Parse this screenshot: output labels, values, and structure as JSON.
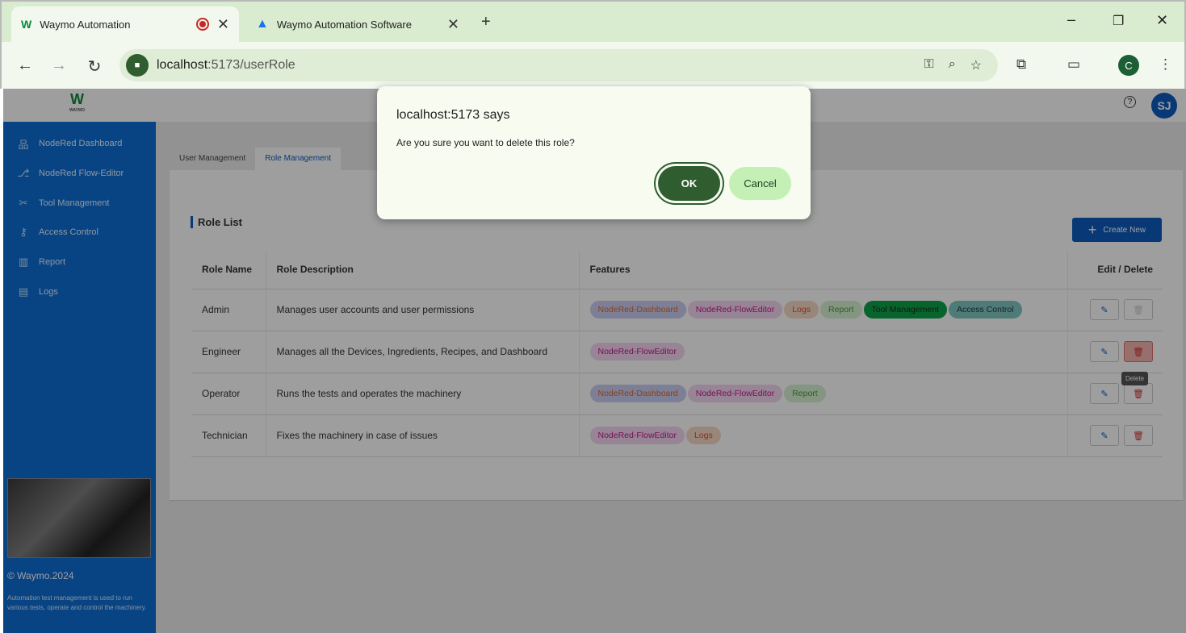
{
  "browser": {
    "tabs": [
      {
        "title": "Waymo Automation",
        "recording": true
      },
      {
        "title": "Waymo Automation Software"
      }
    ],
    "url_host": "localhost",
    "url_rest": ":5173/userRole",
    "profile_initial": "C"
  },
  "app": {
    "logo_text": "W",
    "logo_sub": "WAYMO",
    "user_initials": "SJ",
    "help_glyph": "?",
    "sidebar": [
      {
        "label": "NodeRed Dashboard",
        "icon": "dashboard-icon"
      },
      {
        "label": "NodeRed Flow-Editor",
        "icon": "flow-icon"
      },
      {
        "label": "Tool Management",
        "icon": "tools-icon"
      },
      {
        "label": "Access Control",
        "icon": "access-icon"
      },
      {
        "label": "Report",
        "icon": "report-icon"
      },
      {
        "label": "Logs",
        "icon": "logs-icon"
      }
    ],
    "copyright": "© Waymo.2024",
    "footer_desc": "Automation test management is used to run various tests, operate and control the machinery.",
    "tabs": [
      "User Management",
      "Role Management"
    ],
    "active_tab": "Role Management",
    "section_title": "Role List",
    "create_label": "Create New",
    "columns": [
      "Role Name",
      "Role Description",
      "Features",
      "Edit / Delete"
    ],
    "rows": [
      {
        "name": "Admin",
        "description": "Manages user accounts and user permissions",
        "features": [
          "NodeRed-Dashboard",
          "NodeRed-FlowEditor",
          "Logs",
          "Report",
          "Tool Management",
          "Access Control"
        ]
      },
      {
        "name": "Engineer",
        "description": "Manages all the Devices, Ingredients, Recipes, and Dashboard",
        "features": [
          "NodeRed-FlowEditor"
        ]
      },
      {
        "name": "Operator",
        "description": "Runs the tests and operates the machinery",
        "features": [
          "NodeRed-Dashboard",
          "NodeRed-FlowEditor",
          "Report"
        ]
      },
      {
        "name": "Technician",
        "description": "Fixes the machinery in case of issues",
        "features": [
          "NodeRed-FlowEditor",
          "Logs"
        ]
      }
    ],
    "tooltip": "Delete"
  },
  "dialog": {
    "title": "localhost:5173 says",
    "message": "Are you sure you want to delete this role?",
    "ok_label": "OK",
    "cancel_label": "Cancel"
  },
  "colors": {
    "chrome_bg": "#d9ecd0",
    "sidebar": "#0d6fd6",
    "accent": "#0d5cbf",
    "ok_button": "#2f5d2f",
    "cancel_button": "#c4f0b5"
  }
}
